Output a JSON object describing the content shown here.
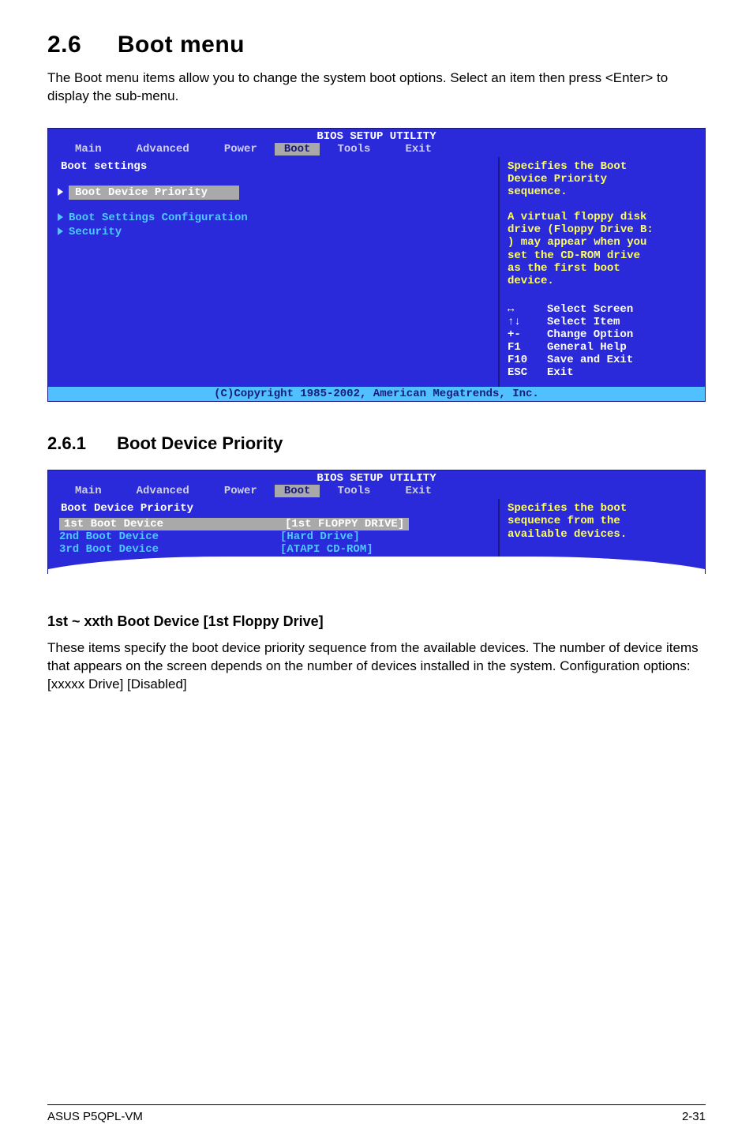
{
  "section": {
    "number": "2.6",
    "title": "Boot menu",
    "intro": "The Boot menu items allow you to change the system boot options. Select an item then press <Enter> to display the sub-menu."
  },
  "bios1": {
    "title": "BIOS SETUP UTILITY",
    "tabs": [
      "Main",
      "Advanced",
      "Power",
      "Boot",
      "Tools",
      "Exit"
    ],
    "selected_tab": "Boot",
    "heading": "Boot settings",
    "items": [
      {
        "label": "Boot Device Priority",
        "selected": true
      },
      {
        "label": "Boot Settings Configuration",
        "selected": false
      },
      {
        "label": "Security",
        "selected": false
      }
    ],
    "help": "Specifies the Boot\nDevice Priority\nsequence.\n\nA virtual floppy disk\ndrive (Floppy Drive B:\n) may appear when you\nset the CD-ROM drive\nas the first boot\ndevice.",
    "keys": [
      {
        "k": "↔",
        "v": "Select Screen"
      },
      {
        "k": "↑↓",
        "v": "Select Item"
      },
      {
        "k": "+-",
        "v": "Change Option"
      },
      {
        "k": "F1",
        "v": "General Help"
      },
      {
        "k": "F10",
        "v": "Save and Exit"
      },
      {
        "k": "ESC",
        "v": "Exit"
      }
    ],
    "footer": "(C)Copyright 1985-2002, American Megatrends, Inc."
  },
  "subsection": {
    "number": "2.6.1",
    "title": "Boot Device Priority"
  },
  "bios2": {
    "title": "BIOS SETUP UTILITY",
    "tabs": [
      "Main",
      "Advanced",
      "Power",
      "Boot",
      "Tools",
      "Exit"
    ],
    "selected_tab": "Boot",
    "heading": "Boot Device Priority",
    "rows": [
      {
        "k": "1st Boot Device",
        "v": "[1st FLOPPY DRIVE]",
        "selected": true
      },
      {
        "k": "2nd Boot Device",
        "v": "[Hard Drive]",
        "selected": false
      },
      {
        "k": "3rd Boot Device",
        "v": "[ATAPI CD-ROM]",
        "selected": false
      }
    ],
    "help": "Specifies the boot\nsequence from the\navailable devices."
  },
  "subsub": {
    "title": "1st ~ xxth Boot Device [1st Floppy Drive]",
    "body": "These items specify the boot device priority sequence from the available devices. The number of device items that appears on the screen depends on the number of devices installed in the system. Configuration options: [xxxxx Drive] [Disabled]"
  },
  "footer": {
    "left": "ASUS P5QPL-VM",
    "right": "2-31"
  }
}
